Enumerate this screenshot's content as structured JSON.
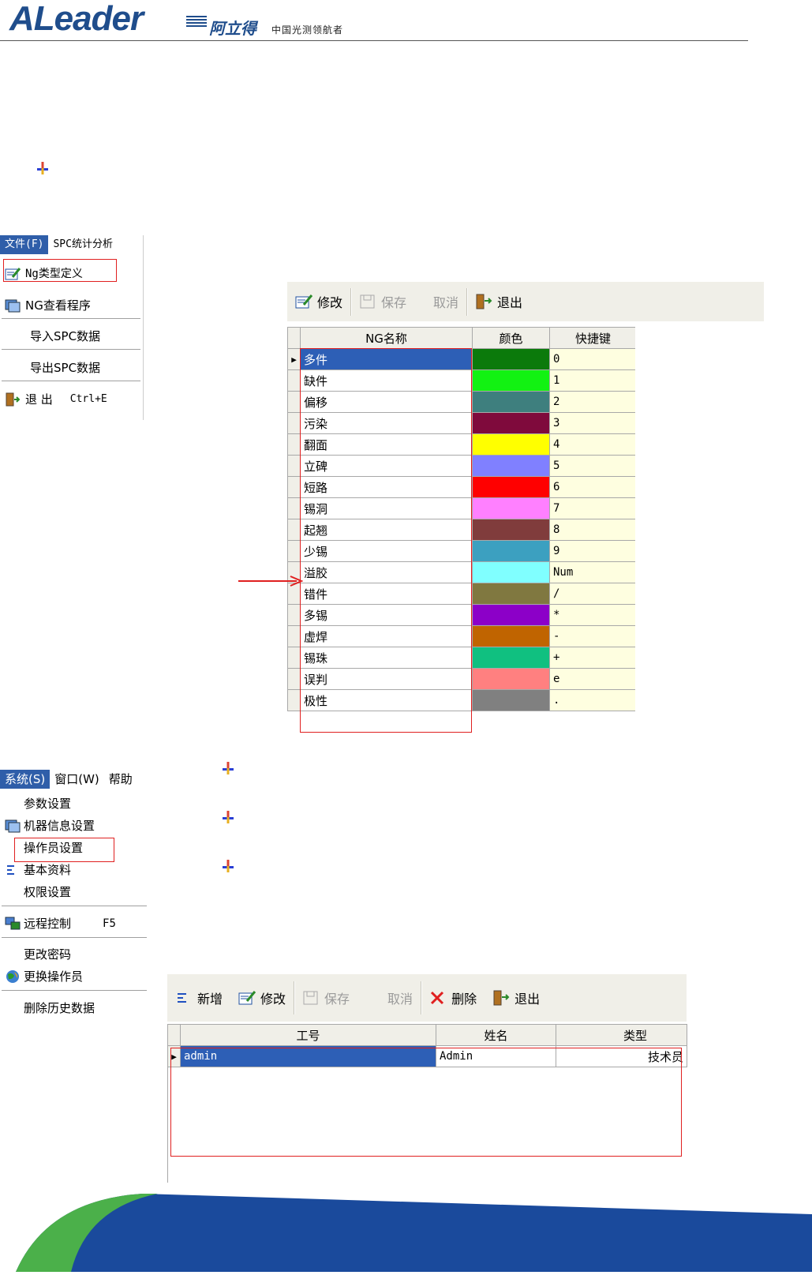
{
  "header": {
    "brand": "ALeader",
    "brand_cn": "阿立得",
    "slogan": "中国光测领航者"
  },
  "file_menu": {
    "bar": [
      "文件(F)",
      "SPC统计分析"
    ],
    "items": [
      {
        "label": "Ng类型定义",
        "icon": "edit-icon",
        "highlighted": true
      },
      {
        "label": "NG查看程序",
        "icon": "viewer-icon"
      },
      {
        "label": "导入SPC数据"
      },
      {
        "label": "导出SPC数据"
      },
      {
        "label": "退 出",
        "shortcut": "Ctrl+E",
        "icon": "exit-icon"
      }
    ]
  },
  "ng_toolbar": {
    "modify": "修改",
    "save": "保存",
    "cancel": "取消",
    "exit": "退出"
  },
  "ng_table": {
    "columns": [
      "NG名称",
      "颜色",
      "快捷键"
    ],
    "rows": [
      {
        "name": "多件",
        "color": "#0b7a0b",
        "key": "0"
      },
      {
        "name": "缺件",
        "color": "#12f212",
        "key": "1"
      },
      {
        "name": "偏移",
        "color": "#3e7f7e",
        "key": "2"
      },
      {
        "name": "污染",
        "color": "#7f0a3c",
        "key": "3"
      },
      {
        "name": "翻面",
        "color": "#ffff00",
        "key": "4"
      },
      {
        "name": "立碑",
        "color": "#8080ff",
        "key": "5"
      },
      {
        "name": "短路",
        "color": "#ff0000",
        "key": "6"
      },
      {
        "name": "锡洞",
        "color": "#ff80ff",
        "key": "7"
      },
      {
        "name": "起翘",
        "color": "#803c3c",
        "key": "8"
      },
      {
        "name": "少锡",
        "color": "#3ca0c0",
        "key": "9"
      },
      {
        "name": "溢胶",
        "color": "#80ffff",
        "key": "Num"
      },
      {
        "name": "错件",
        "color": "#807840",
        "key": "/"
      },
      {
        "name": "多锡",
        "color": "#8c00c8",
        "key": "*"
      },
      {
        "name": "虚焊",
        "color": "#c06400",
        "key": "-"
      },
      {
        "name": "锡珠",
        "color": "#10c080",
        "key": "+"
      },
      {
        "name": "误判",
        "color": "#ff8080",
        "key": "e"
      },
      {
        "name": "极性",
        "color": "#808080",
        "key": "."
      }
    ]
  },
  "system_menu": {
    "bar": [
      "系统(S)",
      "窗口(W)",
      "帮助"
    ],
    "items": [
      {
        "label": "参数设置"
      },
      {
        "label": "机器信息设置",
        "icon": "machine-icon"
      },
      {
        "label": "操作员设置",
        "highlighted": true
      },
      {
        "label": "基本资料",
        "icon": "basic-data-icon"
      },
      {
        "label": "权限设置"
      },
      {
        "label": "远程控制",
        "shortcut": "F5",
        "icon": "remote-icon"
      },
      {
        "label": "更改密码"
      },
      {
        "label": "更换操作员",
        "icon": "globe-icon"
      },
      {
        "label": "删除历史数据"
      }
    ]
  },
  "op_toolbar": {
    "add": "新增",
    "modify": "修改",
    "save": "保存",
    "cancel": "取消",
    "delete": "删除",
    "exit": "退出"
  },
  "op_table": {
    "columns": [
      "工号",
      "姓名",
      "类型"
    ],
    "rows": [
      {
        "id": "admin",
        "name": "Admin",
        "type": "技术员"
      }
    ]
  },
  "colors": {
    "brand": "#1f4d8c",
    "selection": "#2d5fb6",
    "highlight_box": "#e02020",
    "toolbar_bg": "#f0efe8"
  }
}
